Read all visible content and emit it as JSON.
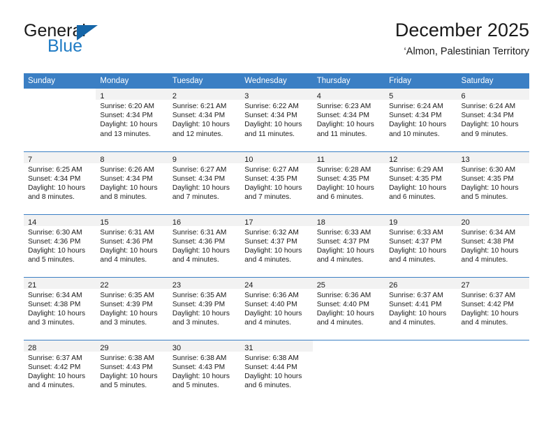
{
  "brand": {
    "name_part1": "General",
    "name_part2": "Blue",
    "accent_color": "#1f7bc4",
    "triangle_color": "#1566a8"
  },
  "header": {
    "title": "December 2025",
    "subtitle": "‘Almon, Palestinian Territory"
  },
  "calendar": {
    "header_bg": "#3b7fc4",
    "daynum_band_bg": "#f2f2f2",
    "weekday_headers": [
      "Sunday",
      "Monday",
      "Tuesday",
      "Wednesday",
      "Thursday",
      "Friday",
      "Saturday"
    ],
    "weeks": [
      [
        {
          "day": "",
          "sunrise": "",
          "sunset": "",
          "daylight_line1": "",
          "daylight_line2": ""
        },
        {
          "day": "1",
          "sunrise": "Sunrise: 6:20 AM",
          "sunset": "Sunset: 4:34 PM",
          "daylight_line1": "Daylight: 10 hours",
          "daylight_line2": "and 13 minutes."
        },
        {
          "day": "2",
          "sunrise": "Sunrise: 6:21 AM",
          "sunset": "Sunset: 4:34 PM",
          "daylight_line1": "Daylight: 10 hours",
          "daylight_line2": "and 12 minutes."
        },
        {
          "day": "3",
          "sunrise": "Sunrise: 6:22 AM",
          "sunset": "Sunset: 4:34 PM",
          "daylight_line1": "Daylight: 10 hours",
          "daylight_line2": "and 11 minutes."
        },
        {
          "day": "4",
          "sunrise": "Sunrise: 6:23 AM",
          "sunset": "Sunset: 4:34 PM",
          "daylight_line1": "Daylight: 10 hours",
          "daylight_line2": "and 11 minutes."
        },
        {
          "day": "5",
          "sunrise": "Sunrise: 6:24 AM",
          "sunset": "Sunset: 4:34 PM",
          "daylight_line1": "Daylight: 10 hours",
          "daylight_line2": "and 10 minutes."
        },
        {
          "day": "6",
          "sunrise": "Sunrise: 6:24 AM",
          "sunset": "Sunset: 4:34 PM",
          "daylight_line1": "Daylight: 10 hours",
          "daylight_line2": "and 9 minutes."
        }
      ],
      [
        {
          "day": "7",
          "sunrise": "Sunrise: 6:25 AM",
          "sunset": "Sunset: 4:34 PM",
          "daylight_line1": "Daylight: 10 hours",
          "daylight_line2": "and 8 minutes."
        },
        {
          "day": "8",
          "sunrise": "Sunrise: 6:26 AM",
          "sunset": "Sunset: 4:34 PM",
          "daylight_line1": "Daylight: 10 hours",
          "daylight_line2": "and 8 minutes."
        },
        {
          "day": "9",
          "sunrise": "Sunrise: 6:27 AM",
          "sunset": "Sunset: 4:34 PM",
          "daylight_line1": "Daylight: 10 hours",
          "daylight_line2": "and 7 minutes."
        },
        {
          "day": "10",
          "sunrise": "Sunrise: 6:27 AM",
          "sunset": "Sunset: 4:35 PM",
          "daylight_line1": "Daylight: 10 hours",
          "daylight_line2": "and 7 minutes."
        },
        {
          "day": "11",
          "sunrise": "Sunrise: 6:28 AM",
          "sunset": "Sunset: 4:35 PM",
          "daylight_line1": "Daylight: 10 hours",
          "daylight_line2": "and 6 minutes."
        },
        {
          "day": "12",
          "sunrise": "Sunrise: 6:29 AM",
          "sunset": "Sunset: 4:35 PM",
          "daylight_line1": "Daylight: 10 hours",
          "daylight_line2": "and 6 minutes."
        },
        {
          "day": "13",
          "sunrise": "Sunrise: 6:30 AM",
          "sunset": "Sunset: 4:35 PM",
          "daylight_line1": "Daylight: 10 hours",
          "daylight_line2": "and 5 minutes."
        }
      ],
      [
        {
          "day": "14",
          "sunrise": "Sunrise: 6:30 AM",
          "sunset": "Sunset: 4:36 PM",
          "daylight_line1": "Daylight: 10 hours",
          "daylight_line2": "and 5 minutes."
        },
        {
          "day": "15",
          "sunrise": "Sunrise: 6:31 AM",
          "sunset": "Sunset: 4:36 PM",
          "daylight_line1": "Daylight: 10 hours",
          "daylight_line2": "and 4 minutes."
        },
        {
          "day": "16",
          "sunrise": "Sunrise: 6:31 AM",
          "sunset": "Sunset: 4:36 PM",
          "daylight_line1": "Daylight: 10 hours",
          "daylight_line2": "and 4 minutes."
        },
        {
          "day": "17",
          "sunrise": "Sunrise: 6:32 AM",
          "sunset": "Sunset: 4:37 PM",
          "daylight_line1": "Daylight: 10 hours",
          "daylight_line2": "and 4 minutes."
        },
        {
          "day": "18",
          "sunrise": "Sunrise: 6:33 AM",
          "sunset": "Sunset: 4:37 PM",
          "daylight_line1": "Daylight: 10 hours",
          "daylight_line2": "and 4 minutes."
        },
        {
          "day": "19",
          "sunrise": "Sunrise: 6:33 AM",
          "sunset": "Sunset: 4:37 PM",
          "daylight_line1": "Daylight: 10 hours",
          "daylight_line2": "and 4 minutes."
        },
        {
          "day": "20",
          "sunrise": "Sunrise: 6:34 AM",
          "sunset": "Sunset: 4:38 PM",
          "daylight_line1": "Daylight: 10 hours",
          "daylight_line2": "and 4 minutes."
        }
      ],
      [
        {
          "day": "21",
          "sunrise": "Sunrise: 6:34 AM",
          "sunset": "Sunset: 4:38 PM",
          "daylight_line1": "Daylight: 10 hours",
          "daylight_line2": "and 3 minutes."
        },
        {
          "day": "22",
          "sunrise": "Sunrise: 6:35 AM",
          "sunset": "Sunset: 4:39 PM",
          "daylight_line1": "Daylight: 10 hours",
          "daylight_line2": "and 3 minutes."
        },
        {
          "day": "23",
          "sunrise": "Sunrise: 6:35 AM",
          "sunset": "Sunset: 4:39 PM",
          "daylight_line1": "Daylight: 10 hours",
          "daylight_line2": "and 3 minutes."
        },
        {
          "day": "24",
          "sunrise": "Sunrise: 6:36 AM",
          "sunset": "Sunset: 4:40 PM",
          "daylight_line1": "Daylight: 10 hours",
          "daylight_line2": "and 4 minutes."
        },
        {
          "day": "25",
          "sunrise": "Sunrise: 6:36 AM",
          "sunset": "Sunset: 4:40 PM",
          "daylight_line1": "Daylight: 10 hours",
          "daylight_line2": "and 4 minutes."
        },
        {
          "day": "26",
          "sunrise": "Sunrise: 6:37 AM",
          "sunset": "Sunset: 4:41 PM",
          "daylight_line1": "Daylight: 10 hours",
          "daylight_line2": "and 4 minutes."
        },
        {
          "day": "27",
          "sunrise": "Sunrise: 6:37 AM",
          "sunset": "Sunset: 4:42 PM",
          "daylight_line1": "Daylight: 10 hours",
          "daylight_line2": "and 4 minutes."
        }
      ],
      [
        {
          "day": "28",
          "sunrise": "Sunrise: 6:37 AM",
          "sunset": "Sunset: 4:42 PM",
          "daylight_line1": "Daylight: 10 hours",
          "daylight_line2": "and 4 minutes."
        },
        {
          "day": "29",
          "sunrise": "Sunrise: 6:38 AM",
          "sunset": "Sunset: 4:43 PM",
          "daylight_line1": "Daylight: 10 hours",
          "daylight_line2": "and 5 minutes."
        },
        {
          "day": "30",
          "sunrise": "Sunrise: 6:38 AM",
          "sunset": "Sunset: 4:43 PM",
          "daylight_line1": "Daylight: 10 hours",
          "daylight_line2": "and 5 minutes."
        },
        {
          "day": "31",
          "sunrise": "Sunrise: 6:38 AM",
          "sunset": "Sunset: 4:44 PM",
          "daylight_line1": "Daylight: 10 hours",
          "daylight_line2": "and 6 minutes."
        },
        {
          "day": "",
          "sunrise": "",
          "sunset": "",
          "daylight_line1": "",
          "daylight_line2": ""
        },
        {
          "day": "",
          "sunrise": "",
          "sunset": "",
          "daylight_line1": "",
          "daylight_line2": ""
        },
        {
          "day": "",
          "sunrise": "",
          "sunset": "",
          "daylight_line1": "",
          "daylight_line2": ""
        }
      ]
    ]
  }
}
